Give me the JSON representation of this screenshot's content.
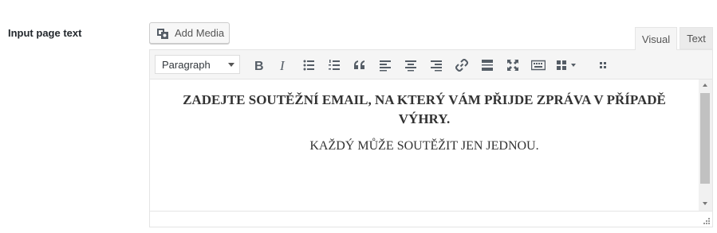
{
  "field": {
    "label": "Input page text"
  },
  "toolbar_top": {
    "add_media_label": "Add Media"
  },
  "tabs": [
    {
      "label": "Visual",
      "active": true
    },
    {
      "label": "Text",
      "active": false
    }
  ],
  "editor": {
    "format_select": {
      "value": "Paragraph"
    },
    "buttons": [
      "bold",
      "italic",
      "bulleted-list",
      "numbered-list",
      "blockquote",
      "align-left",
      "align-center",
      "align-right",
      "link",
      "read-more",
      "fullscreen",
      "toolbar-toggle",
      "insert-grid",
      "grid-dropdown",
      "extra"
    ],
    "content": {
      "heading": "ZADEJTE SOUTĚŽNÍ EMAIL, NA KTERÝ VÁM PŘIJDE ZPRÁVA V PŘÍPADĚ VÝHRY.",
      "paragraph": "KAŽDÝ MŮŽE SOUTĚŽIT JEN JEDNOU."
    }
  },
  "colors": {
    "icon": "#555d66",
    "text": "#333333",
    "toolbar_bg": "#f5f5f5"
  }
}
